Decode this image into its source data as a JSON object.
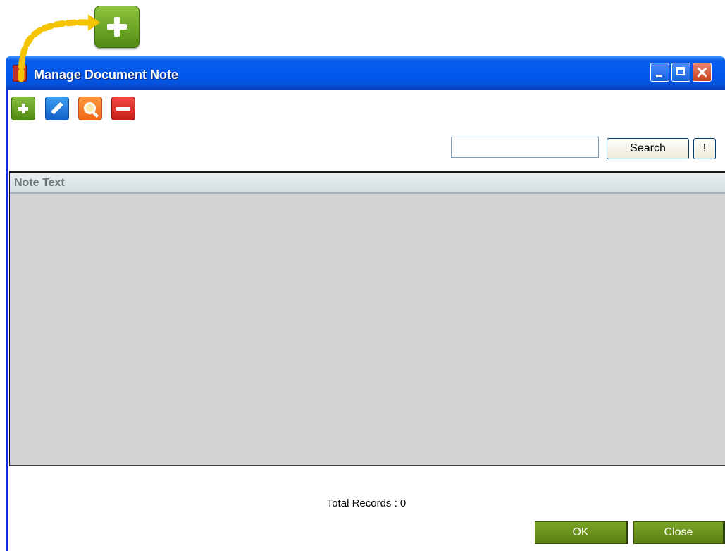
{
  "callout": {
    "icon": "add-icon",
    "color": "#6aa329",
    "arrow_color": "#f5c400"
  },
  "window": {
    "title": "Manage Document Note",
    "titlebar_color": "#0058ee",
    "controls": [
      "minimize",
      "maximize",
      "close"
    ]
  },
  "toolbar": {
    "buttons": [
      {
        "name": "add",
        "icon": "plus-icon",
        "color": "#6aa329"
      },
      {
        "name": "edit",
        "icon": "pencil-icon",
        "color": "#1f7ad8"
      },
      {
        "name": "view",
        "icon": "magnifier-icon",
        "color": "#f47a22"
      },
      {
        "name": "delete",
        "icon": "minus-icon",
        "color": "#d92b25"
      }
    ]
  },
  "search": {
    "value": "",
    "button_label": "Search",
    "clear_label": "!"
  },
  "grid": {
    "columns": [
      "Note Text"
    ],
    "rows": []
  },
  "footer": {
    "total_records": "Total Records : 0",
    "ok_label": "OK",
    "close_label": "Close",
    "button_color": "#6b9216"
  }
}
